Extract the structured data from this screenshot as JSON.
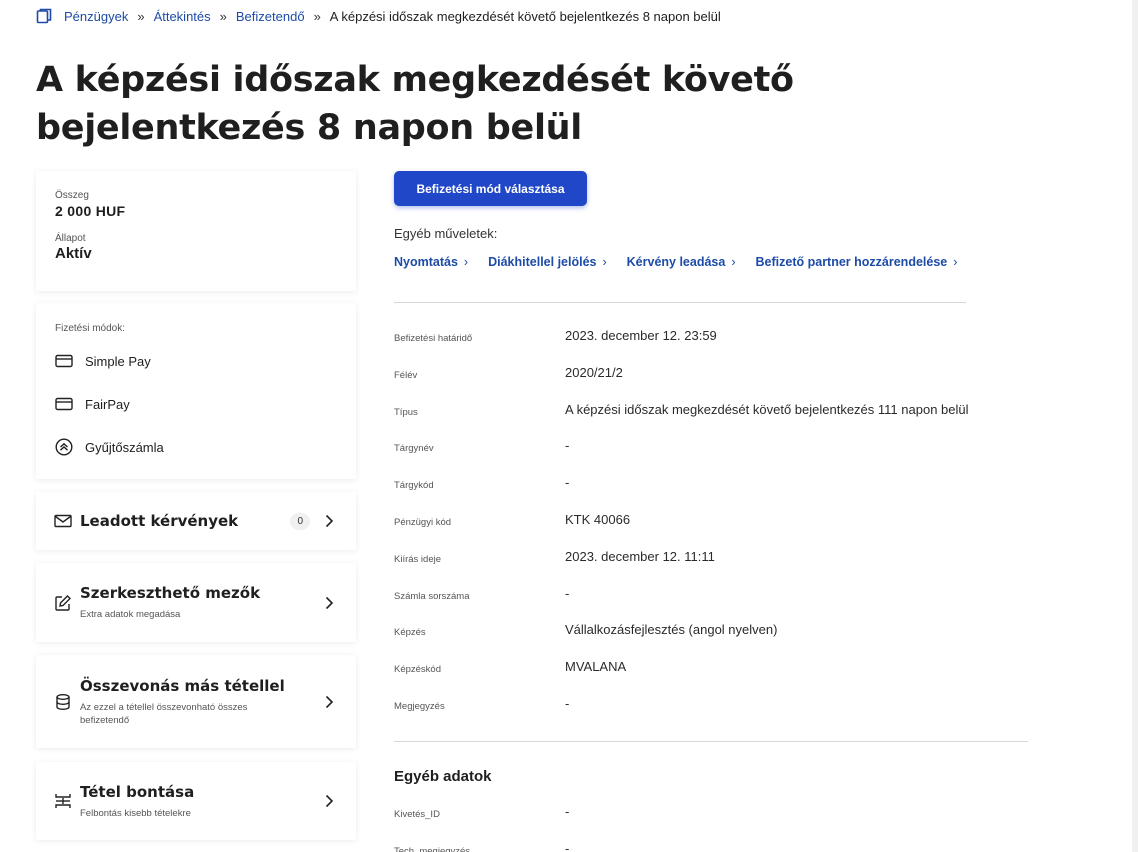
{
  "breadcrumb": {
    "items": [
      "Pénzügyek",
      "Áttekintés",
      "Befizetendő"
    ],
    "separator": "»",
    "current": "A képzési időszak megkezdését követő bejelentkezés 8 napon belül"
  },
  "page_title": "A képzési időszak megkezdését követő bejelentkezés 8 napon belül",
  "summary": {
    "amount_label": "Összeg",
    "amount": "2 000 HUF",
    "state_label": "Állapot",
    "state": "Aktív"
  },
  "payment_methods": {
    "label": "Fizetési módok:",
    "items": [
      {
        "label": "Simple Pay",
        "icon": "credit-card-icon"
      },
      {
        "label": "FairPay",
        "icon": "credit-card-icon"
      },
      {
        "label": "Gyűjtőszámla",
        "icon": "collect-account-icon"
      }
    ]
  },
  "nav_cards": [
    {
      "title": "Leadott kérvények",
      "subtitle": "",
      "badge": "0",
      "icon": "mail-icon"
    },
    {
      "title": "Szerkeszthető mezők",
      "subtitle": "Extra adatok megadása",
      "icon": "edit-icon"
    },
    {
      "title": "Összevonás más tétellel",
      "subtitle": "Az ezzel a tétellel összevonható összes befizetendő",
      "icon": "database-icon"
    },
    {
      "title": "Tétel bontása",
      "subtitle": "Felbontás kisebb tételekre",
      "icon": "split-icon"
    }
  ],
  "actions": {
    "pay_button": "Befizetési mód választása",
    "other_label": "Egyéb műveletek:",
    "links": [
      "Nyomtatás",
      "Diákhitellel jelölés",
      "Kérvény leadása",
      "Befizető partner hozzárendelése"
    ],
    "link_chevron": "›"
  },
  "details": [
    {
      "key": "Befizetési határidő",
      "value": "2023. december 12. 23:59"
    },
    {
      "key": "Félév",
      "value": "2020/21/2"
    },
    {
      "key": "Típus",
      "value": "A képzési időszak megkezdését követő bejelentkezés 111 napon belül"
    },
    {
      "key": "Tárgynév",
      "value": "-"
    },
    {
      "key": "Tárgykód",
      "value": "-"
    },
    {
      "key": "Pénzügyi kód",
      "value": "KTK 40066"
    },
    {
      "key": "Kiírás ideje",
      "value": "2023. december 12. 11:11"
    },
    {
      "key": "Számla sorszáma",
      "value": "-"
    },
    {
      "key": "Képzés",
      "value": "Vállalkozásfejlesztés (angol nyelven)"
    },
    {
      "key": "Képzéskód",
      "value": "MVALANA"
    },
    {
      "key": "Megjegyzés",
      "value": "-"
    }
  ],
  "other_data": {
    "title": "Egyéb adatok",
    "rows": [
      {
        "key": "Kivetés_ID",
        "value": "-"
      },
      {
        "key": "Tech_megjegyzés",
        "value": "-"
      }
    ]
  },
  "colors": {
    "accent": "#1f47c8",
    "link": "#1d4ba8"
  }
}
